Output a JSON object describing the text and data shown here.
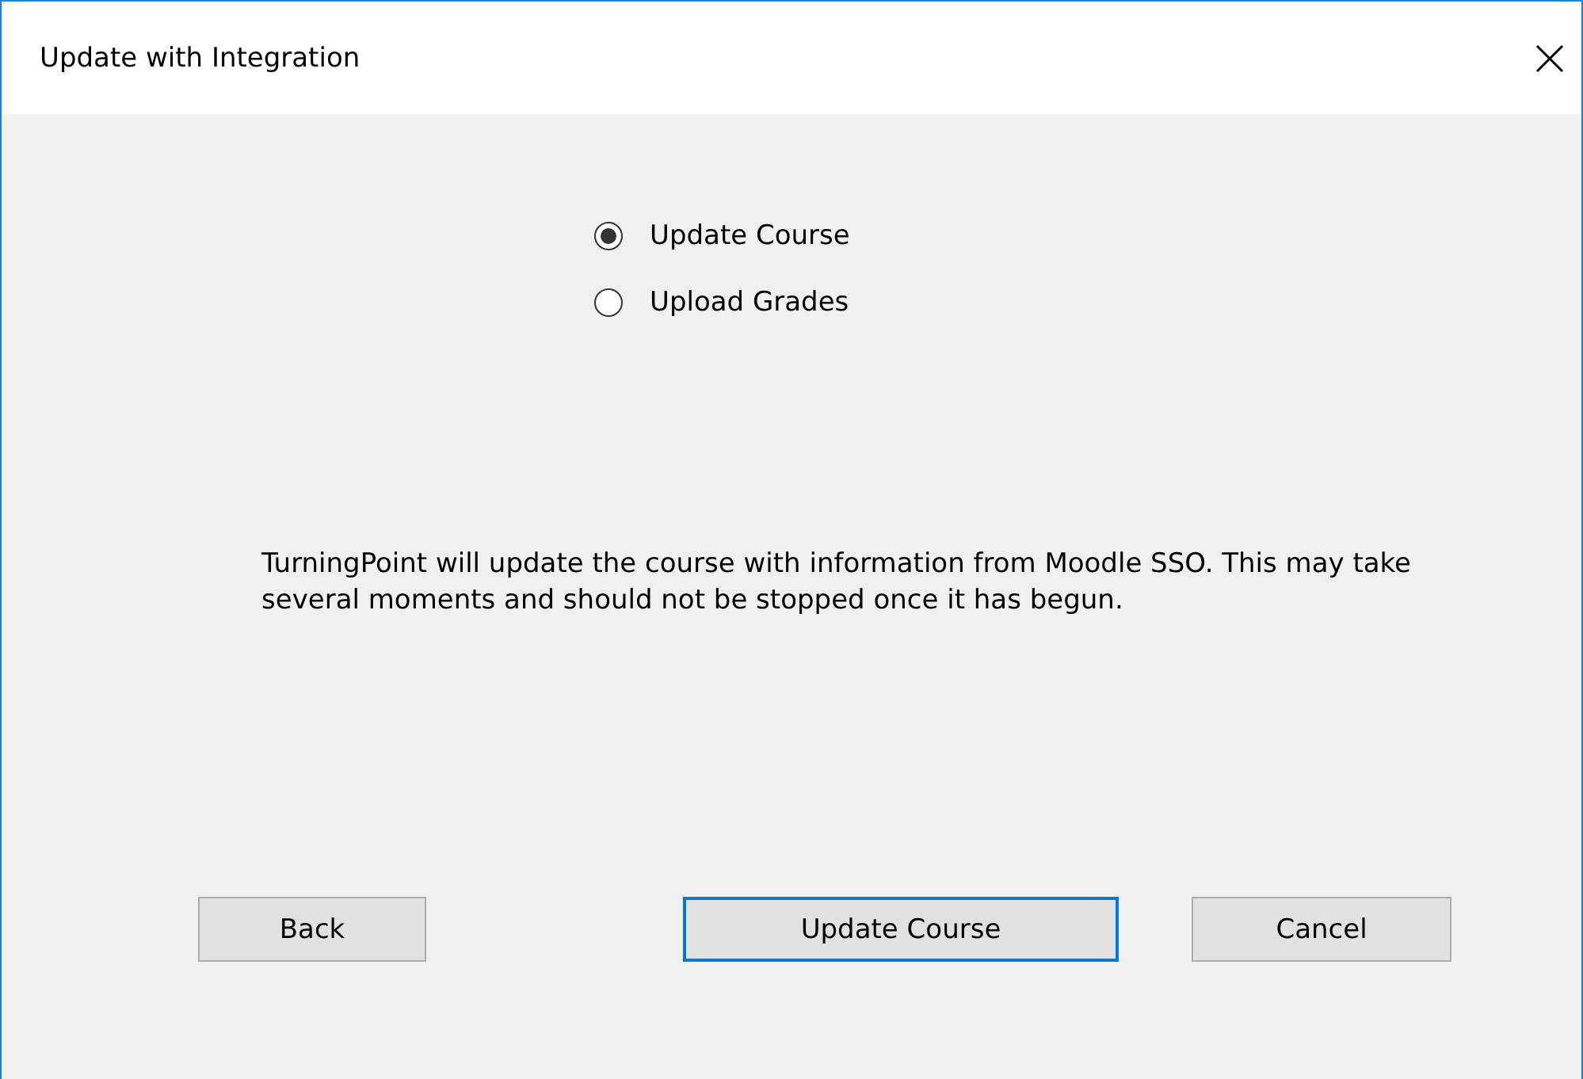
{
  "window": {
    "title": "Update with Integration"
  },
  "options": [
    {
      "label": "Update Course",
      "selected": true
    },
    {
      "label": "Upload Grades",
      "selected": false
    }
  ],
  "message": "TurningPoint will update the course with information from Moodle SSO. This may take several moments and should not be stopped once it has begun.",
  "buttons": [
    {
      "label": "Back",
      "default": false
    },
    {
      "label": "Update Course",
      "default": true
    },
    {
      "label": "Cancel",
      "default": false
    }
  ]
}
